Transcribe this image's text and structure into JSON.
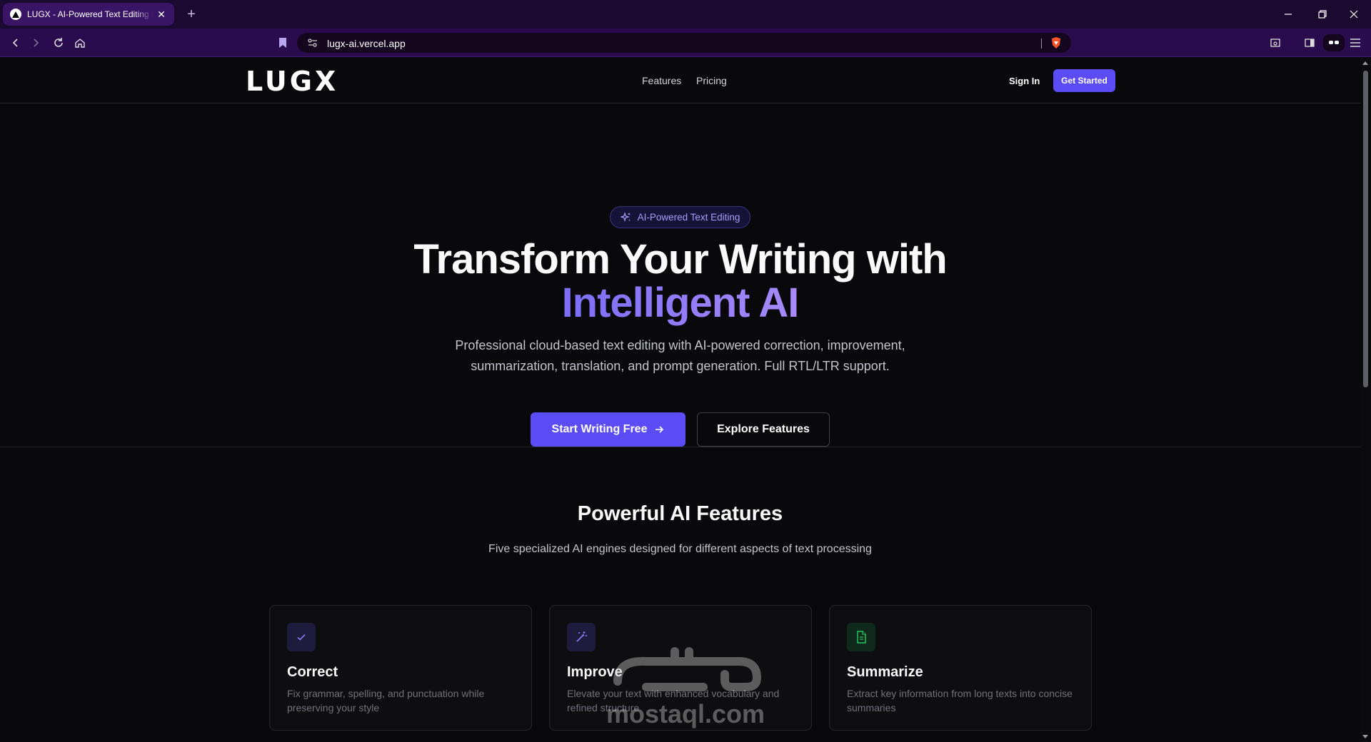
{
  "browser": {
    "tab_title": "LUGX - AI-Powered Text Editing Platform",
    "new_tab_icon": "plus-icon",
    "url": "lugx-ai.vercel.app",
    "accent": "#2a0c4e"
  },
  "nav": {
    "logo_text": "LUGX",
    "links": [
      "Features",
      "Pricing"
    ],
    "sign_in": "Sign In",
    "get_started": "Get Started"
  },
  "hero": {
    "badge": "AI-Powered Text Editing",
    "title_line1": "Transform Your Writing with",
    "title_line2": "Intelligent AI",
    "subtitle_line1": "Professional cloud-based text editing with AI-powered correction, improvement,",
    "subtitle_line2": "summarization, translation, and prompt generation. Full RTL/LTR support.",
    "primary_cta": "Start Writing Free",
    "secondary_cta": "Explore Features"
  },
  "features": {
    "title": "Powerful AI Features",
    "subtitle": "Five specialized AI engines designed for different aspects of text processing",
    "cards": [
      {
        "title": "Correct",
        "description": "Fix grammar, spelling, and punctuation while preserving your style",
        "icon": "check-icon",
        "icon_color": "#8b7cf6"
      },
      {
        "title": "Improve",
        "description": "Elevate your text with enhanced vocabulary and refined structure",
        "icon": "magic-wand-icon",
        "icon_color": "#8b7cf6"
      },
      {
        "title": "Summarize",
        "description": "Extract key information from long texts into concise summaries",
        "icon": "document-icon",
        "icon_color": "#22c55e"
      }
    ]
  },
  "watermark": {
    "latin": "mostaql.com"
  },
  "colors": {
    "primary": "#5b4cf5",
    "gradient_start": "#7c6cf7",
    "gradient_end": "#a78bfa",
    "background": "#09090b"
  }
}
